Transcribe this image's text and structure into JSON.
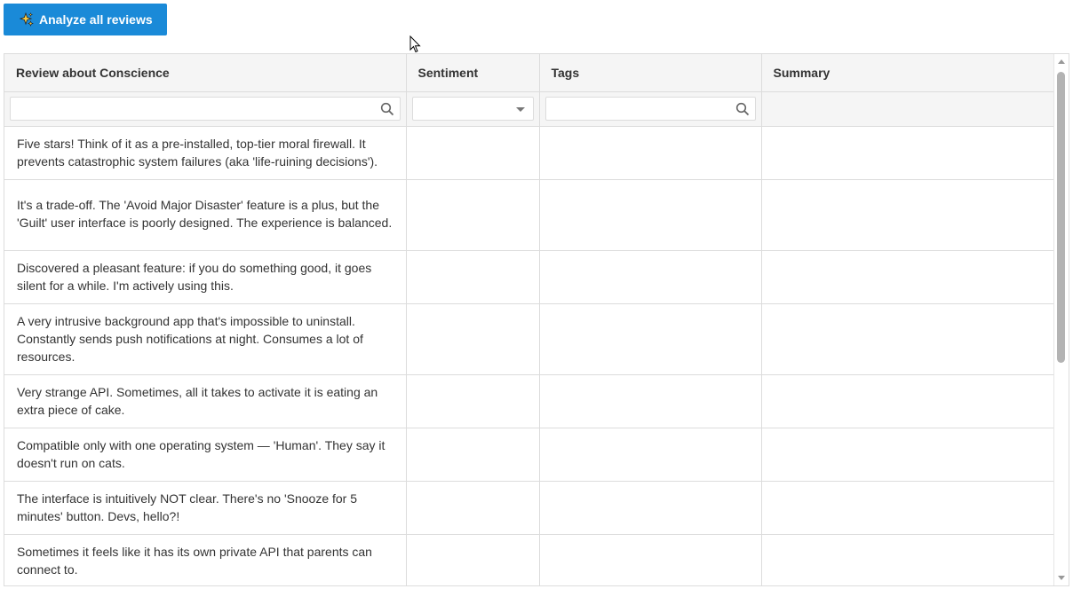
{
  "toolbar": {
    "analyze_label": "Analyze all reviews",
    "analyze_icon": "sparkles-icon"
  },
  "grid": {
    "columns": [
      "Review about Conscience",
      "Sentiment",
      "Tags",
      "Summary"
    ],
    "rows": [
      {
        "review": "Five stars! Think of it as a pre-installed, top-tier moral firewall. It prevents catastrophic system failures (aka 'life-ruining decisions').",
        "sentiment": "",
        "tags": "",
        "summary": ""
      },
      {
        "review": "It's a trade-off. The 'Avoid Major Disaster' feature is a plus, but the 'Guilt' user interface is poorly designed. The experience is balanced.",
        "sentiment": "",
        "tags": "",
        "summary": ""
      },
      {
        "review": "Discovered a pleasant feature: if you do something good, it goes silent for a while. I'm actively using this.",
        "sentiment": "",
        "tags": "",
        "summary": ""
      },
      {
        "review": "A very intrusive background app that's impossible to uninstall. Constantly sends push notifications at night. Consumes a lot of resources.",
        "sentiment": "",
        "tags": "",
        "summary": ""
      },
      {
        "review": "Very strange API. Sometimes, all it takes to activate it is eating an extra piece of cake.",
        "sentiment": "",
        "tags": "",
        "summary": ""
      },
      {
        "review": "Compatible only with one operating system — 'Human'. They say it doesn't run on cats.",
        "sentiment": "",
        "tags": "",
        "summary": ""
      },
      {
        "review": "The interface is intuitively NOT clear. There's no 'Snooze for 5 minutes' button. Devs, hello?!",
        "sentiment": "",
        "tags": "",
        "summary": ""
      },
      {
        "review": "Sometimes it feels like it has its own private API that parents can connect to.",
        "sentiment": "",
        "tags": "",
        "summary": ""
      }
    ]
  },
  "colors": {
    "accent": "#1a8ad8",
    "header_bg": "#f5f5f5",
    "border": "#dcdcdc"
  }
}
